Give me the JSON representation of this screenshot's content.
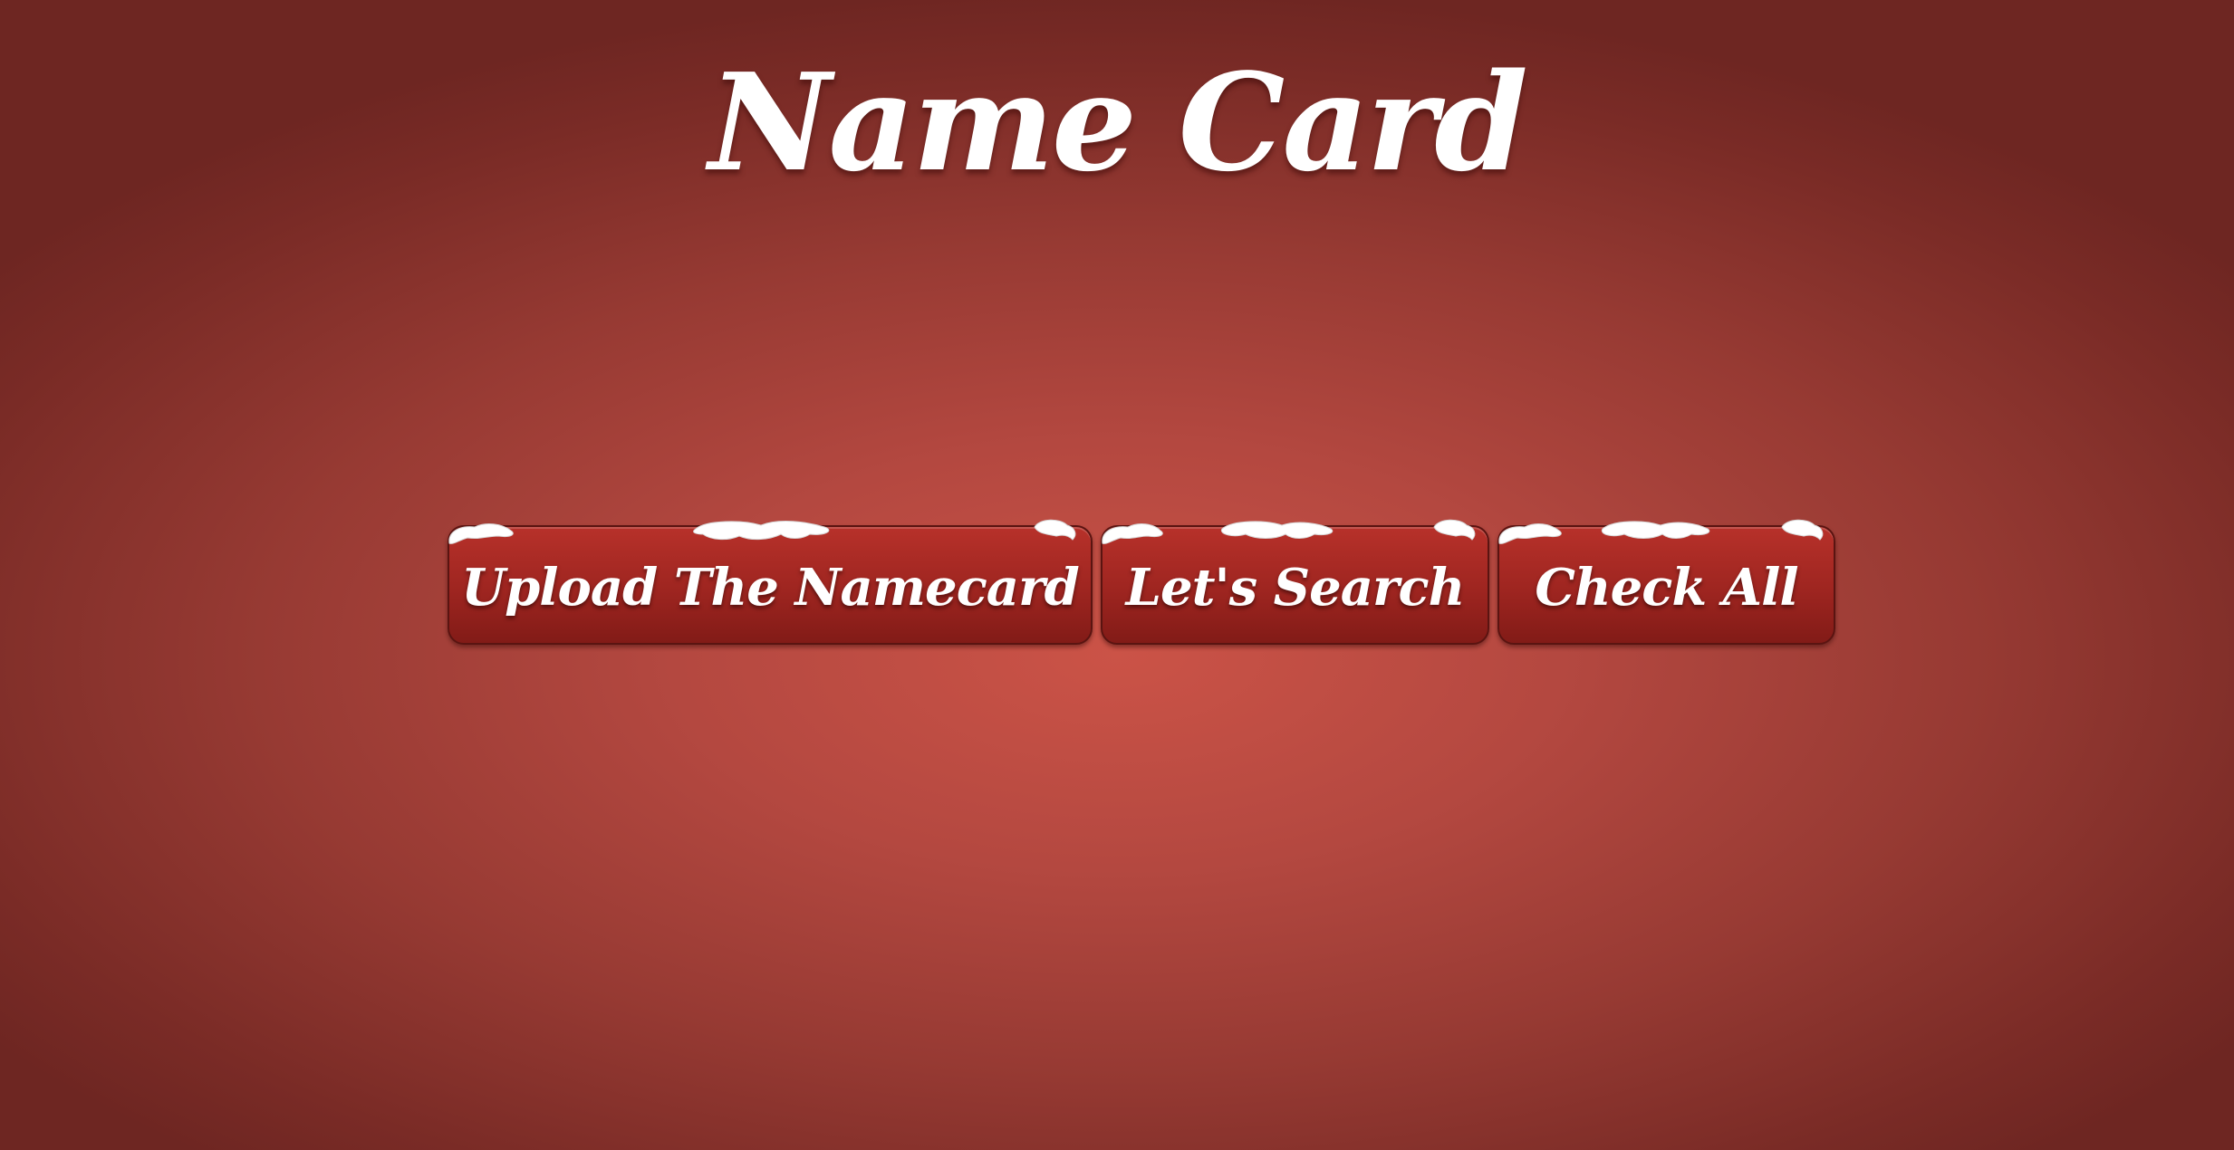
{
  "page": {
    "title": "Name Card"
  },
  "actions": {
    "upload_label": "Upload The Namecard",
    "search_label": "Let's Search",
    "check_all_label": "Check All"
  },
  "theme": {
    "background": "#b44840",
    "button": "#9e2520",
    "snow": "#ffffff",
    "text": "#ffffff"
  }
}
